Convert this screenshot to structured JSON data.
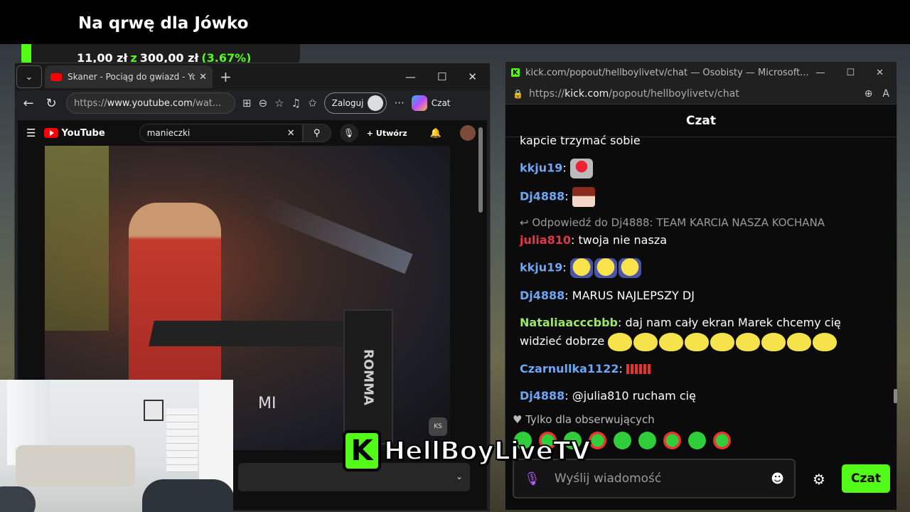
{
  "goal": {
    "title": "Na qrwę dla Jówko",
    "current": "11,00 zł",
    "connector": "z",
    "target": "300,00 zł",
    "percent": "(3.67%)",
    "progress_fraction": 0.0367
  },
  "browser": {
    "tab_title": "Skaner - Pociąg do gwiazd - YouTube",
    "url_prefix": "https://",
    "url_host": "www.youtube.com",
    "url_rest": "/wat...",
    "login_label": "Zaloguj",
    "copilot_label": "Czat"
  },
  "youtube": {
    "logo_text": "YouTube",
    "search_value": "manieczki",
    "create_label": "Utwórz",
    "video_sign": "ROMMA",
    "video_text_mi": "MI",
    "watermark": "KS"
  },
  "kick": {
    "window_title": "kick.com/popout/hellboylivetv/chat — Osobisty — Microsoft...",
    "url_prefix": "https://",
    "url_host": "kick.com",
    "url_rest": "/popout/hellboylivetv/chat",
    "chat_header": "Czat",
    "messages": [
      {
        "user": "",
        "text": "kapcie trzymać sobie"
      },
      {
        "user": "kkju19",
        "text": ""
      },
      {
        "user": "Dj4888",
        "text": ""
      },
      {
        "reply": "Odpowiedź do Dj4888: TEAM KARCIA NASZA KOCHANA",
        "user": "julia810",
        "text": "twoja nie nasza"
      },
      {
        "user": "kkju19",
        "text": ""
      },
      {
        "user": "Dj4888",
        "text": "MARUS NAJLEPSZY DJ"
      },
      {
        "user": "Nataliaacccbbb",
        "text": "daj nam cały ekran Marek chcemy cię widzieć dobrze"
      },
      {
        "user": "Czarnullka1122",
        "text": ""
      },
      {
        "user": "Dj4888",
        "text": "@julia810 rucham cię"
      }
    ],
    "user_colors": {
      "kkju19": "#6ea6f4",
      "Dj4888": "#6ea6f4",
      "julia810": "#e8334a",
      "Nataliaacccbbb": "#9be86a",
      "Czarnullka1122": "#6ea6f4"
    },
    "follow_notice": "Tylko dla obserwujących",
    "input_placeholder": "Wyślij wiadomość",
    "send_label": "Czat",
    "accent": "#53fc18"
  },
  "channel": {
    "logo_letter": "K",
    "name": "HellBoyLiveTV"
  }
}
